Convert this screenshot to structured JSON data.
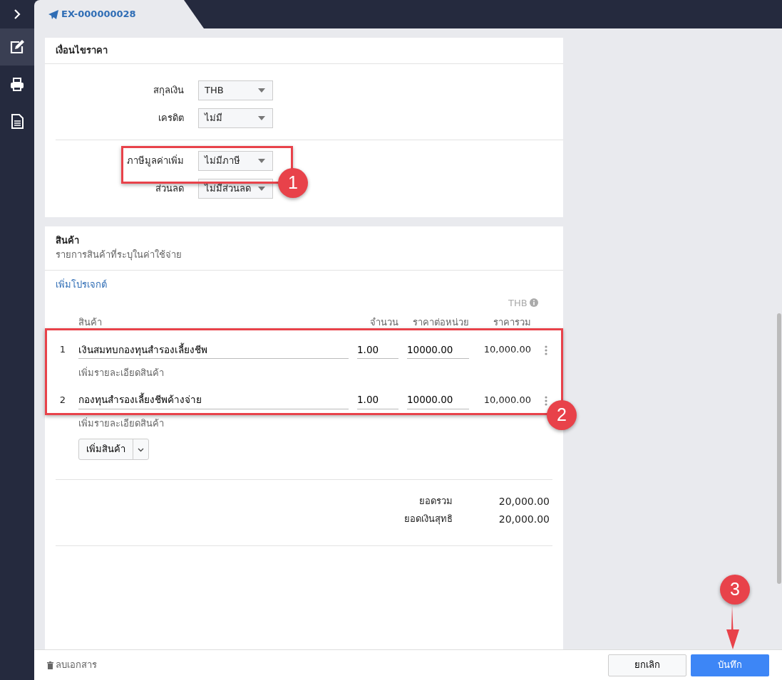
{
  "sidebar": {
    "items": [
      {
        "kind": "edit",
        "selected": true
      },
      {
        "kind": "print",
        "selected": false
      },
      {
        "kind": "document",
        "selected": false
      }
    ]
  },
  "tab": {
    "title": "EX-000000028"
  },
  "price_conditions": {
    "title": "เงื่อนไขราคา",
    "groups": [
      [
        {
          "label": "สกุลเงิน",
          "value": "THB"
        },
        {
          "label": "เครดิต",
          "value": "ไม่มี"
        }
      ],
      [
        {
          "label": "ภาษีมูลค่าเพิ่ม",
          "value": "ไม่มีภาษี"
        },
        {
          "label": "ส่วนลด",
          "value": "ไม่มีส่วนลด"
        }
      ]
    ]
  },
  "products": {
    "title": "สินค้า",
    "subtitle": "รายการสินค้าที่ระบุในค่าใช้จ่าย",
    "add_project": "เพิ่มโปรเจกต์",
    "currency": "THB",
    "columns": [
      "สินค้า",
      "จำนวน",
      "ราคาต่อหน่วย",
      "ราคารวม"
    ],
    "rows": [
      {
        "number": "1",
        "name": "เงินสมทบกองทุนสำรองเลี้ยงชีพ",
        "quantity": "1.00",
        "unit_price": "10000.00",
        "total": "10,000.00",
        "detail_link": "เพิ่มรายละเอียดสินค้า"
      },
      {
        "number": "2",
        "name": "กองทุนสำรองเลี้ยงชีพค้างจ่าย",
        "quantity": "1.00",
        "unit_price": "10000.00",
        "total": "10,000.00",
        "detail_link": "เพิ่มรายละเอียดสินค้า"
      }
    ],
    "add_button": "เพิ่มสินค้า",
    "totals": [
      {
        "label": "ยอดรวม",
        "value": "20,000.00"
      },
      {
        "label": "ยอดเงินสุทธิ",
        "value": "20,000.00"
      }
    ]
  },
  "footer": {
    "delete": "ลบเอกสาร",
    "cancel": "ยกเลิก",
    "save": "บันทึก"
  },
  "annotations": [
    {
      "label": "1"
    },
    {
      "label": "2"
    },
    {
      "label": "3"
    }
  ]
}
